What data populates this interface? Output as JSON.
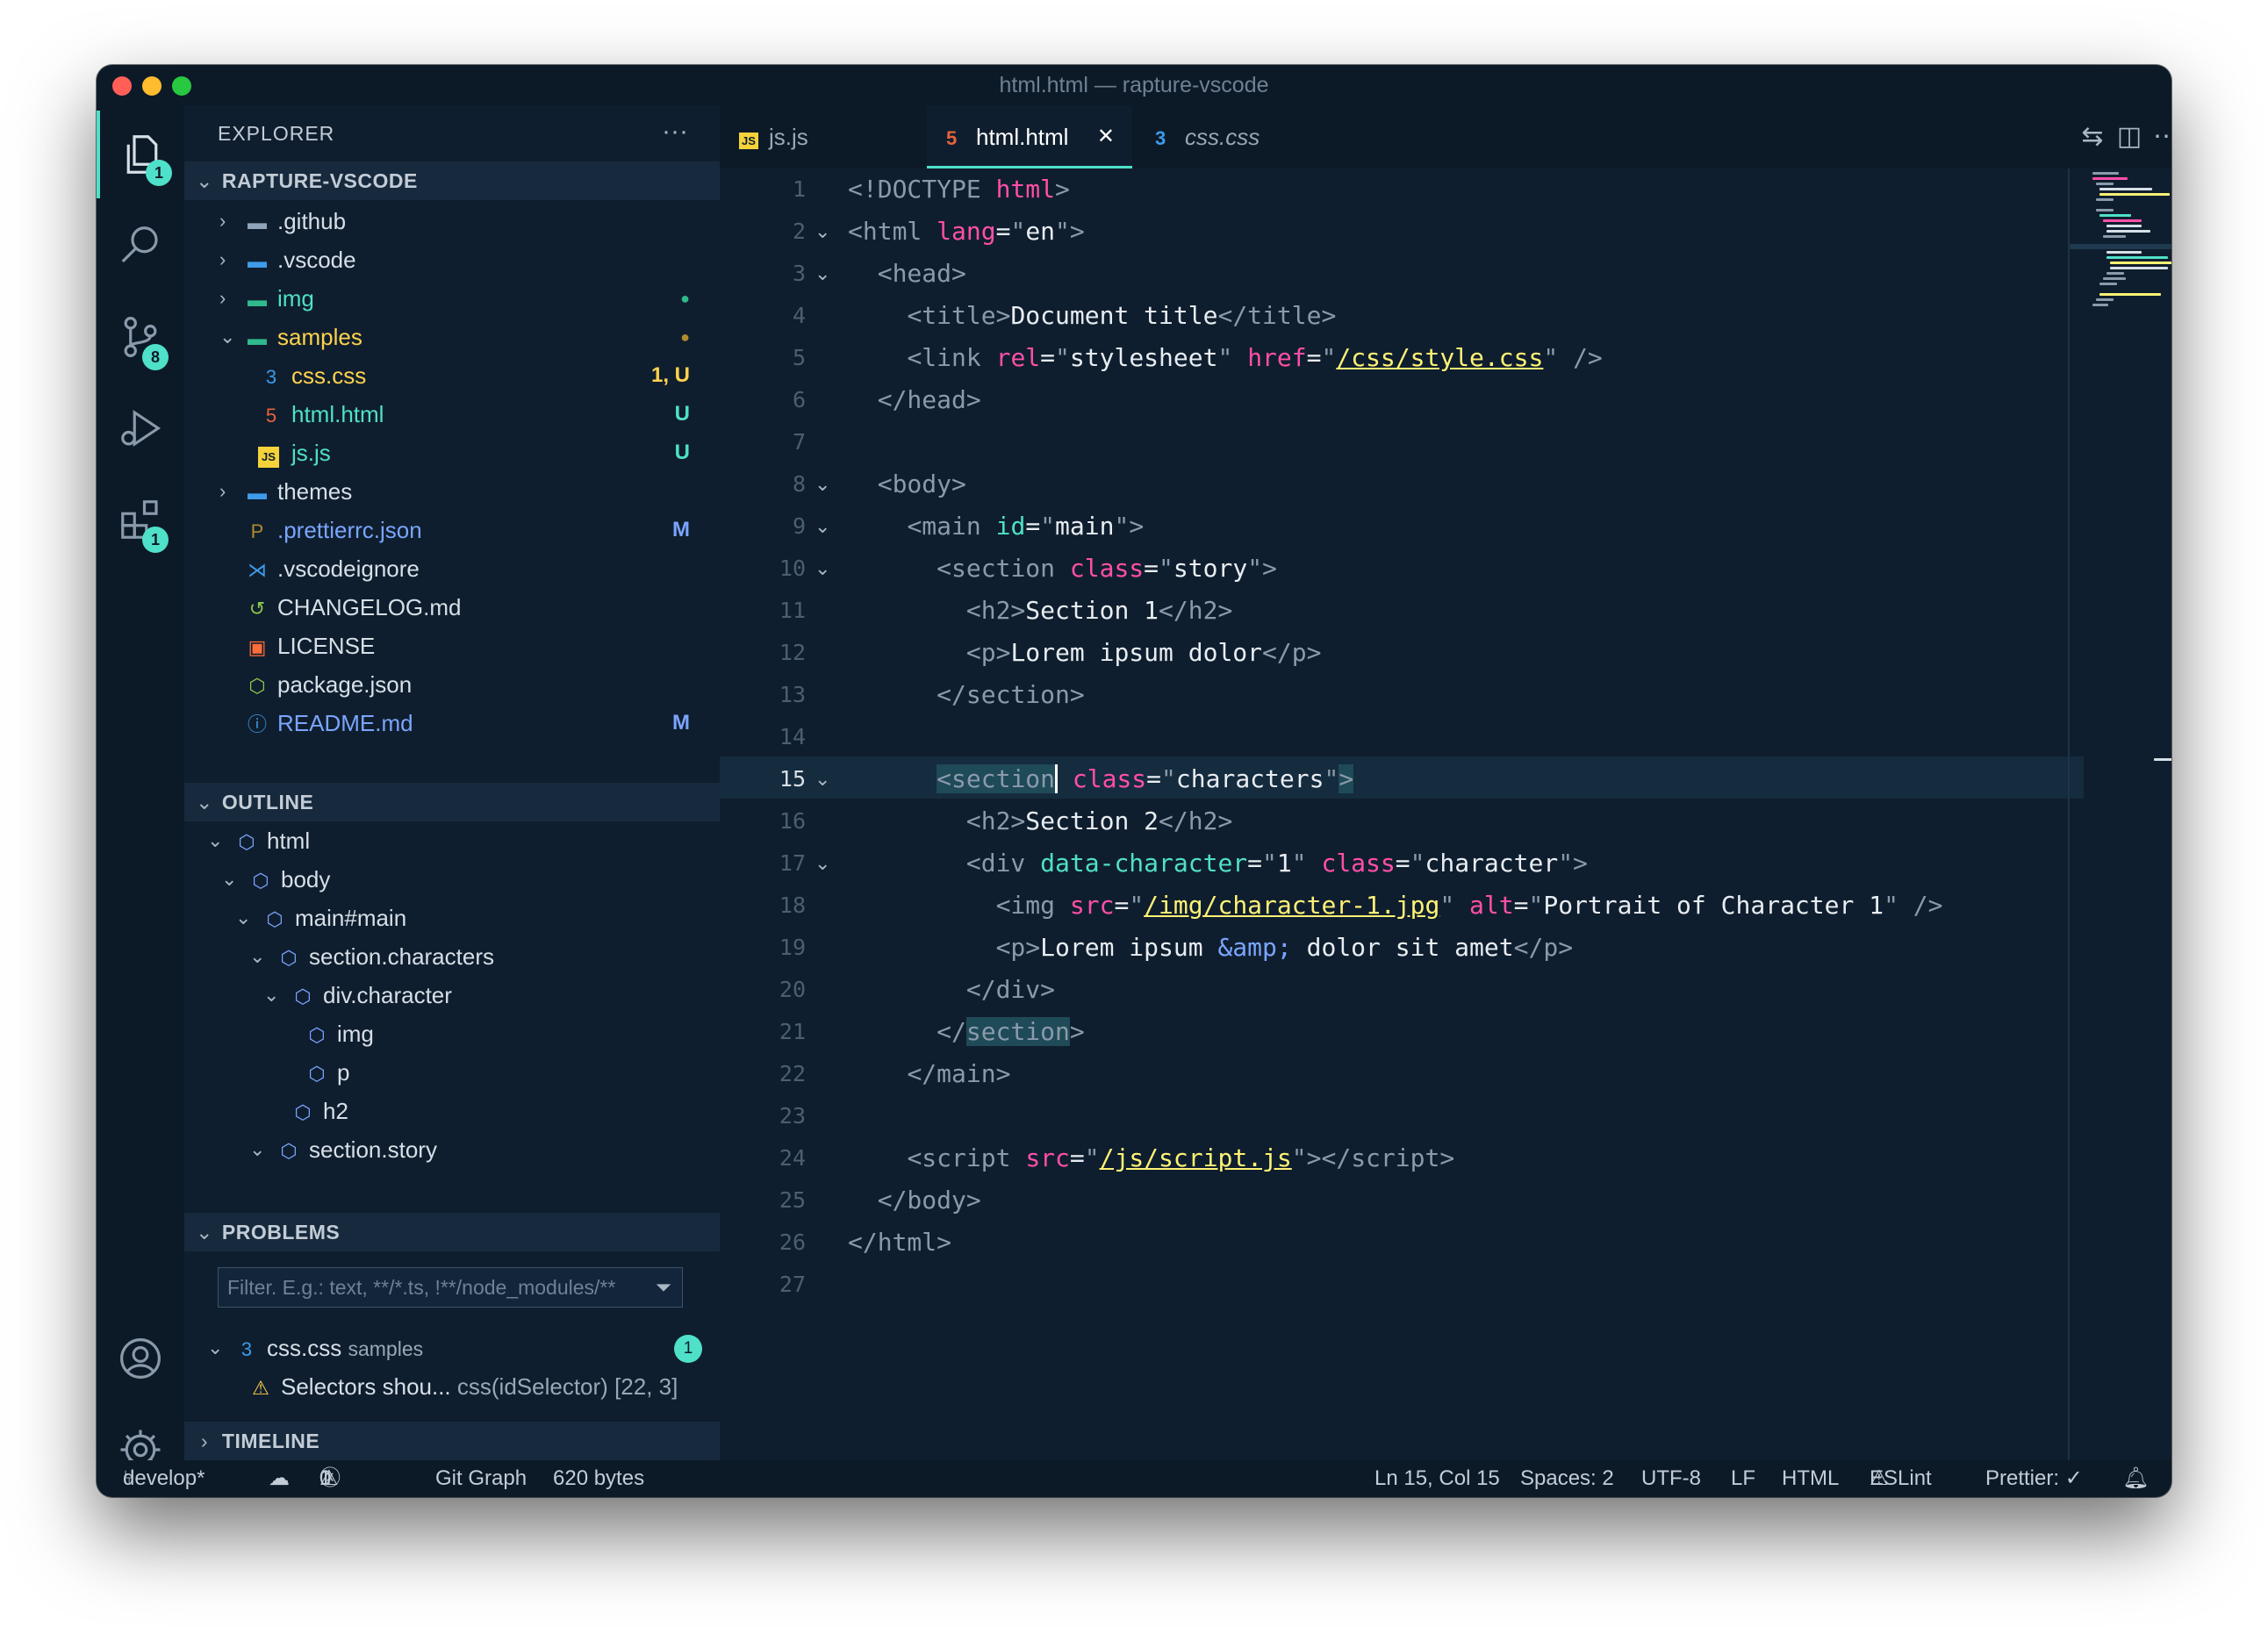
{
  "window": {
    "title": "html.html — rapture-vscode"
  },
  "colors": {
    "accent": "#4fe0c9",
    "background": "#0f1e2e",
    "tag": "#4fe0c9",
    "attr": "#ff4fa8",
    "string": "#ffffff",
    "link": "#fff275",
    "modified": "#7aa5ff",
    "untracked": "#ffd24d"
  },
  "activity": {
    "explorer_badge": "1",
    "scm_badge": "8",
    "extensions_badge": "1"
  },
  "explorer": {
    "title": "EXPLORER",
    "more": "···",
    "root": "RAPTURE-VSCODE",
    "items": [
      {
        "name": ".github",
        "icon": "github-folder-icon",
        "status": ""
      },
      {
        "name": ".vscode",
        "icon": "vscode-folder-icon",
        "status": ""
      },
      {
        "name": "img",
        "icon": "image-folder-icon",
        "status": "●"
      },
      {
        "name": "samples",
        "icon": "folder-open-icon",
        "status": "●"
      },
      {
        "name": "css.css",
        "icon": "css-icon",
        "status": "1, U"
      },
      {
        "name": "html.html",
        "icon": "html-icon",
        "status": "U"
      },
      {
        "name": "js.js",
        "icon": "js-icon",
        "status": "U"
      },
      {
        "name": "themes",
        "icon": "themes-folder-icon",
        "status": ""
      },
      {
        "name": ".prettierrc.json",
        "icon": "prettier-icon",
        "status": "M"
      },
      {
        "name": ".vscodeignore",
        "icon": "vscode-icon",
        "status": ""
      },
      {
        "name": "CHANGELOG.md",
        "icon": "changelog-icon",
        "status": ""
      },
      {
        "name": "LICENSE",
        "icon": "license-icon",
        "status": ""
      },
      {
        "name": "package.json",
        "icon": "nodejs-icon",
        "status": ""
      },
      {
        "name": "README.md",
        "icon": "info-icon",
        "status": "M"
      }
    ]
  },
  "outline": {
    "title": "OUTLINE",
    "items": [
      "html",
      "body",
      "main#main",
      "section.characters",
      "div.character",
      "img",
      "p",
      "h2",
      "section.story"
    ]
  },
  "problems": {
    "title": "PROBLEMS",
    "filter_placeholder": "Filter. E.g.: text, **/*.ts, !**/node_modules/**",
    "file": "css.css",
    "folder": "samples",
    "count": "1",
    "message": "Selectors shou...",
    "source": "css(idSelector)",
    "location": "[22, 3]"
  },
  "timeline": {
    "title": "TIMELINE"
  },
  "tabs": [
    {
      "label": "js.js",
      "icon": "JS"
    },
    {
      "label": "html.html",
      "icon": "5"
    },
    {
      "label": "css.css",
      "icon": "3"
    }
  ],
  "tab_close": "✕",
  "editor": {
    "current_line": 15,
    "line_numbers": [
      "1",
      "2",
      "3",
      "4",
      "5",
      "6",
      "7",
      "8",
      "9",
      "10",
      "11",
      "12",
      "13",
      "14",
      "15",
      "16",
      "17",
      "18",
      "19",
      "20",
      "21",
      "22",
      "23",
      "24",
      "25",
      "26",
      "27"
    ]
  },
  "status": {
    "branch": "develop*",
    "errors": "0",
    "warnings": "1",
    "git_graph": "Git Graph",
    "size": "620 bytes",
    "position": "Ln 15, Col 15",
    "spaces": "Spaces: 2",
    "encoding": "UTF-8",
    "eol": "LF",
    "language": "HTML",
    "eslint": "ESLint",
    "prettier": "Prettier: ✓"
  }
}
